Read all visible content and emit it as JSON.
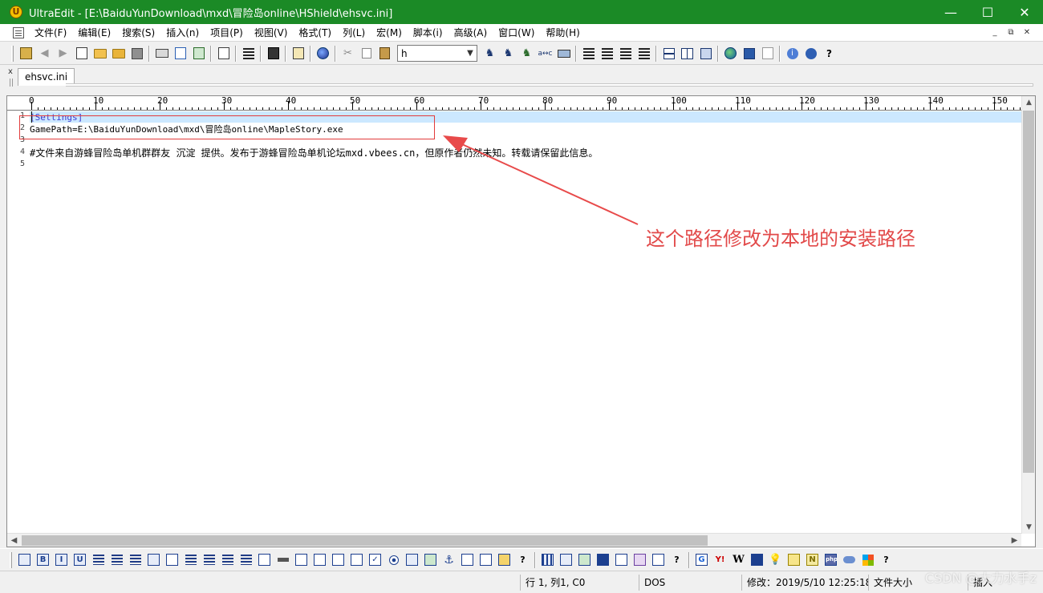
{
  "window": {
    "title": "UltraEdit - [E:\\BaiduYunDownload\\mxd\\冒险岛online\\HShield\\ehsvc.ini]",
    "controls": {
      "minimize": "—",
      "maximize": "☐",
      "close": "✕"
    },
    "titlebar_color": "#1b8a26"
  },
  "menu": {
    "items": [
      "文件(F)",
      "编辑(E)",
      "搜索(S)",
      "插入(n)",
      "项目(P)",
      "视图(V)",
      "格式(T)",
      "列(L)",
      "宏(M)",
      "脚本(i)",
      "高级(A)",
      "窗口(W)",
      "帮助(H)"
    ],
    "mdi_controls": {
      "minimize": "_",
      "restore": "⧉",
      "close": "✕"
    }
  },
  "toolbar": {
    "search_value": "h",
    "help_label": "?"
  },
  "tabs": {
    "close_label": "x",
    "items": [
      "ehsvc.ini"
    ]
  },
  "ruler": {
    "labels": [
      "0",
      "10",
      "20",
      "30",
      "40",
      "50",
      "60",
      "70",
      "80",
      "90",
      "100",
      "110",
      "120",
      "130",
      "140",
      "150"
    ]
  },
  "editor": {
    "line_numbers": [
      "1",
      "2",
      "3",
      "4",
      "5"
    ],
    "lines": [
      "[Settings]",
      "GamePath=E:\\BaiduYunDownload\\mxd\\冒险岛online\\MapleStory.exe",
      "",
      "#文件来自游蜂冒险岛单机群群友 沉淀 提供。发布于游蜂冒险岛单机论坛mxd.vbees.cn，但原作者仍然未知。转载请保留此信息。",
      ""
    ]
  },
  "annotation": {
    "text": "这个路径修改为本地的安装路径",
    "color": "#e24a4a"
  },
  "bottom_toolbar": {
    "help_label": "?",
    "format_letters": [
      "B",
      "I",
      "U"
    ],
    "lookup_letters": [
      "G",
      "Y!",
      "W",
      "N",
      "php"
    ]
  },
  "status": {
    "position": "行 1, 列1, C0",
    "line_ending": "DOS",
    "modified": "修改：2019/5/10 12:25:18",
    "file_size": "文件大小",
    "insert_mode": "插入"
  },
  "watermark": "CSDN @大力水手z"
}
